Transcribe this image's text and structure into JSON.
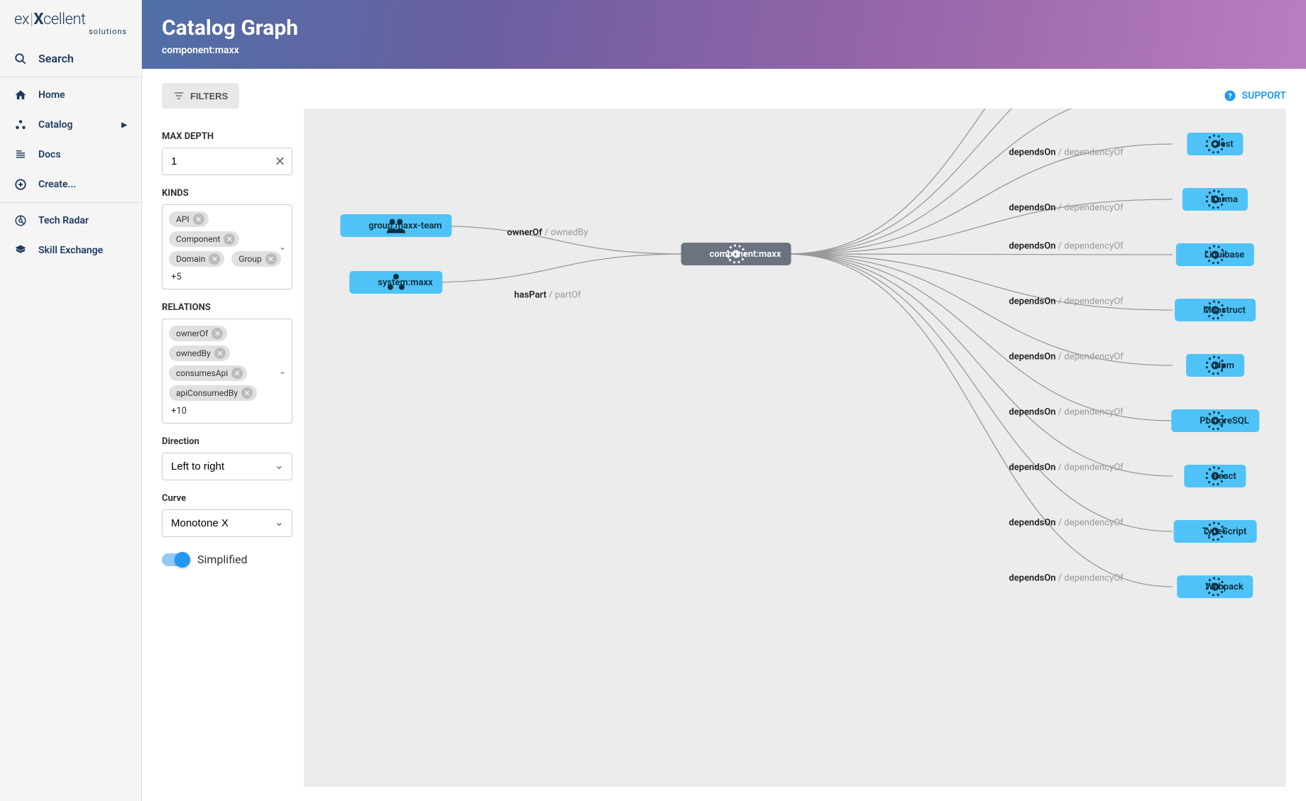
{
  "sidebar": {
    "search": "Search",
    "items": [
      {
        "label": "Home"
      },
      {
        "label": "Catalog",
        "expandable": true
      },
      {
        "label": "Docs"
      },
      {
        "label": "Create..."
      }
    ],
    "items2": [
      {
        "label": "Tech Radar"
      },
      {
        "label": "Skill Exchange"
      }
    ]
  },
  "header": {
    "title": "Catalog Graph",
    "subtitle": "component:maxx"
  },
  "toolbar": {
    "filters": "FILTERS",
    "support": "SUPPORT"
  },
  "filters": {
    "maxDepthLabel": "MAX DEPTH",
    "maxDepth": "1",
    "kindsLabel": "KINDS",
    "kinds": [
      "API",
      "Component",
      "Domain",
      "Group"
    ],
    "kindsMore": "+5",
    "relationsLabel": "RELATIONS",
    "relations": [
      "ownerOf",
      "ownedBy",
      "consumesApi",
      "apiConsumedBy"
    ],
    "relationsMore": "+10",
    "directionLabel": "Direction",
    "direction": "Left to right",
    "curveLabel": "Curve",
    "curve": "Monotone X",
    "simplified": "Simplified"
  },
  "graph": {
    "center": "component:maxx",
    "leftNodes": [
      {
        "label": "group:maxx-team",
        "relPrim": "ownerOf",
        "relSec": "ownedBy"
      },
      {
        "label": "system:maxx",
        "relPrim": "hasPart",
        "relSec": "partOf"
      }
    ],
    "rightNodes": [
      {
        "label": "Jest"
      },
      {
        "label": "Karma"
      },
      {
        "label": "Liquibase"
      },
      {
        "label": "Mapstruct"
      },
      {
        "label": "Npm"
      },
      {
        "label": "PostgreSQL"
      },
      {
        "label": "React"
      },
      {
        "label": "TypeScript"
      },
      {
        "label": "Webpack"
      }
    ],
    "rightRelPrim": "dependsOn",
    "rightRelSec": "dependencyOf"
  }
}
